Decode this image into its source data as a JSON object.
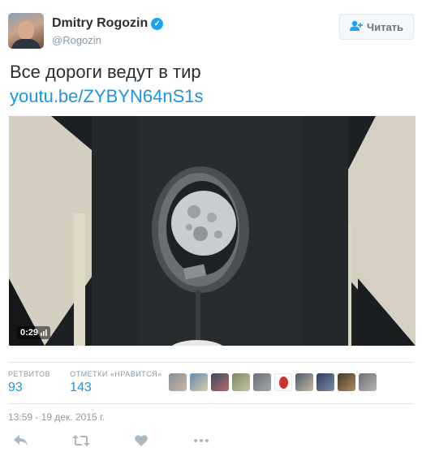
{
  "author": {
    "name": "Dmitry Rogozin",
    "handle": "@Rogozin",
    "avatar_icon": "profile-photo"
  },
  "follow_button": {
    "label": "Читать",
    "icon": "follow-plus-icon"
  },
  "tweet": {
    "text": "Все дороги ведут в тир",
    "link": "youtu.be/ZYBYN64nS1s"
  },
  "media": {
    "duration": "0:29"
  },
  "stats": {
    "retweets_label": "РЕТВИТОВ",
    "retweets_value": "93",
    "likes_label": "ОТМЕТКИ «НРАВИТСЯ»",
    "likes_value": "143"
  },
  "timestamp": "13:59 - 19 дек. 2015 г.",
  "colors": {
    "link": "#1b95e0",
    "verified": "#1da1f2",
    "muted": "#8899a6",
    "icon": "#aab8c2"
  },
  "actions": [
    "reply-icon",
    "retweet-icon",
    "like-icon",
    "more-icon"
  ]
}
